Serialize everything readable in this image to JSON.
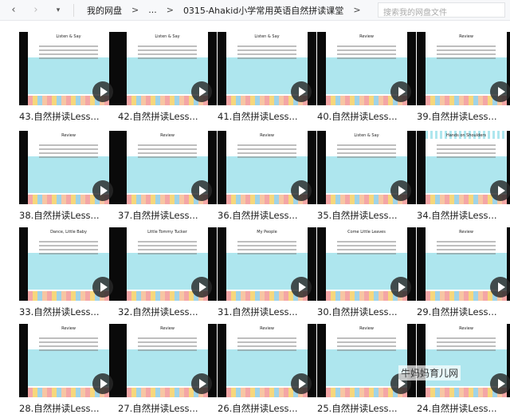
{
  "toolbar": {
    "back_icon": "chevron-left-icon",
    "forward_icon": "chevron-right-icon",
    "dropdown_icon": "caret-down-icon",
    "breadcrumbs": [
      "我的网盘",
      "...",
      "0315-Ahakid小学常用英语自然拼读课堂"
    ],
    "separator": ">",
    "search_placeholder": "搜索我的网盘文件"
  },
  "files": [
    {
      "label": "43.自然拼读Less...",
      "slide_title": "Listen & Say"
    },
    {
      "label": "42.自然拼读Less...",
      "slide_title": "Listen & Say"
    },
    {
      "label": "41.自然拼读Less...",
      "slide_title": "Listen & Say"
    },
    {
      "label": "40.自然拼读Less...",
      "slide_title": "Review"
    },
    {
      "label": "39.自然拼读Less...",
      "slide_title": "Review"
    },
    {
      "label": "38.自然拼读Less...",
      "slide_title": "Review"
    },
    {
      "label": "37.自然拼读Less...",
      "slide_title": "Review"
    },
    {
      "label": "36.自然拼读Less...",
      "slide_title": "Review"
    },
    {
      "label": "35.自然拼读Less...",
      "slide_title": "Listen & Say"
    },
    {
      "label": "34.自然拼读Less...",
      "slide_title": "Hands on Shoulders"
    },
    {
      "label": "33.自然拼读Less...",
      "slide_title": "Dance, Little Baby"
    },
    {
      "label": "32.自然拼读Less...",
      "slide_title": "Little Tommy Tucker"
    },
    {
      "label": "31.自然拼读Less...",
      "slide_title": "My People"
    },
    {
      "label": "30.自然拼读Less...",
      "slide_title": "Come Little Leaves"
    },
    {
      "label": "29.自然拼读Less...",
      "slide_title": "Review"
    },
    {
      "label": "28.自然拼读Less...",
      "slide_title": "Review"
    },
    {
      "label": "27.自然拼读Less...",
      "slide_title": "Review"
    },
    {
      "label": "26.自然拼读Less...",
      "slide_title": "Review"
    },
    {
      "label": "25.自然拼读Less...",
      "slide_title": "Review"
    },
    {
      "label": "24.自然拼读Less...",
      "slide_title": "Review"
    }
  ],
  "watermark": "牛妈妈育儿网"
}
